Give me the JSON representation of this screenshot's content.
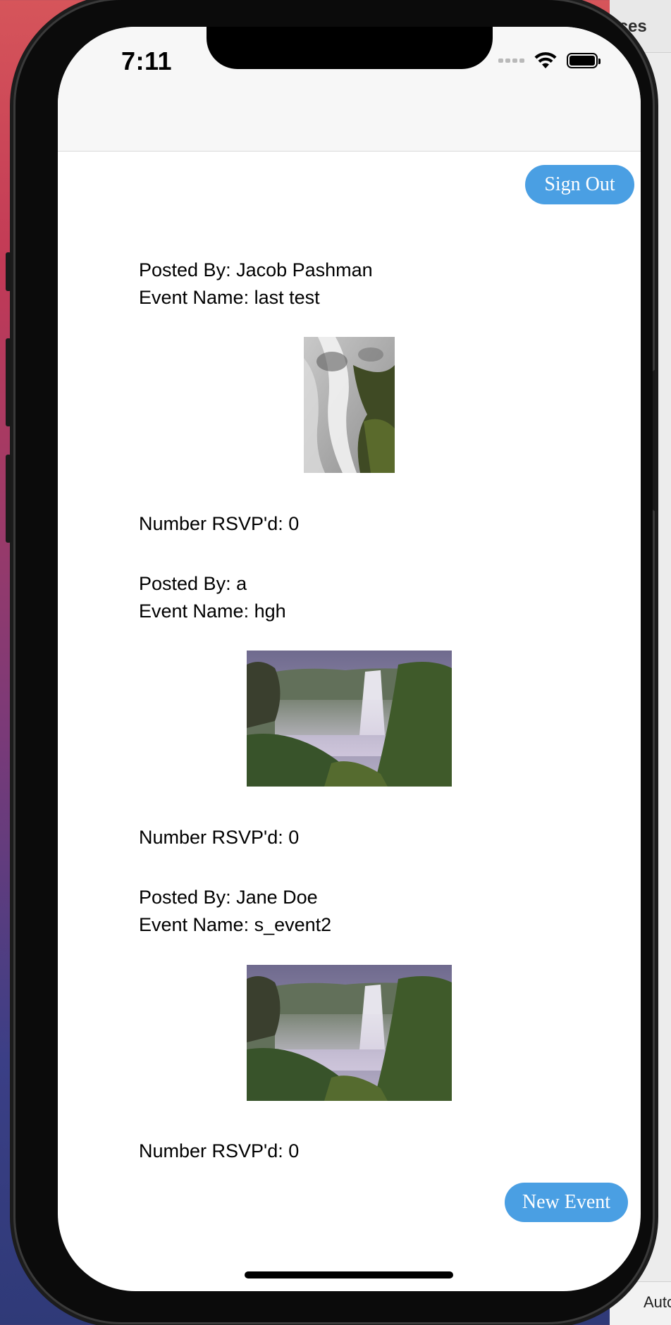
{
  "background_window": {
    "title_fragment": "ices",
    "footer_fragment": "Auto"
  },
  "status_bar": {
    "time": "7:11",
    "icons": [
      "cellular-signal-icon",
      "wifi-icon",
      "battery-icon"
    ]
  },
  "header": {
    "sign_out_label": "Sign Out"
  },
  "events": [
    {
      "posted_by": "Posted By: Jacob Pashman",
      "event_name": "Event Name: last test",
      "image": "waterfall-closeup",
      "rsvp": "Number RSVP'd: 0"
    },
    {
      "posted_by": "Posted By: a",
      "event_name": "Event Name: hgh",
      "image": "waterfall-landscape",
      "rsvp": "Number RSVP'd: 0"
    },
    {
      "posted_by": "Posted By: Jane Doe",
      "event_name": "Event Name: s_event2",
      "image": "waterfall-landscape",
      "rsvp": "Number RSVP'd: 0"
    }
  ],
  "footer": {
    "new_event_label": "New Event"
  },
  "colors": {
    "accent_button": "#4a9fe3",
    "status_bar_bg": "#f7f7f7",
    "screen_bg": "#ffffff"
  }
}
